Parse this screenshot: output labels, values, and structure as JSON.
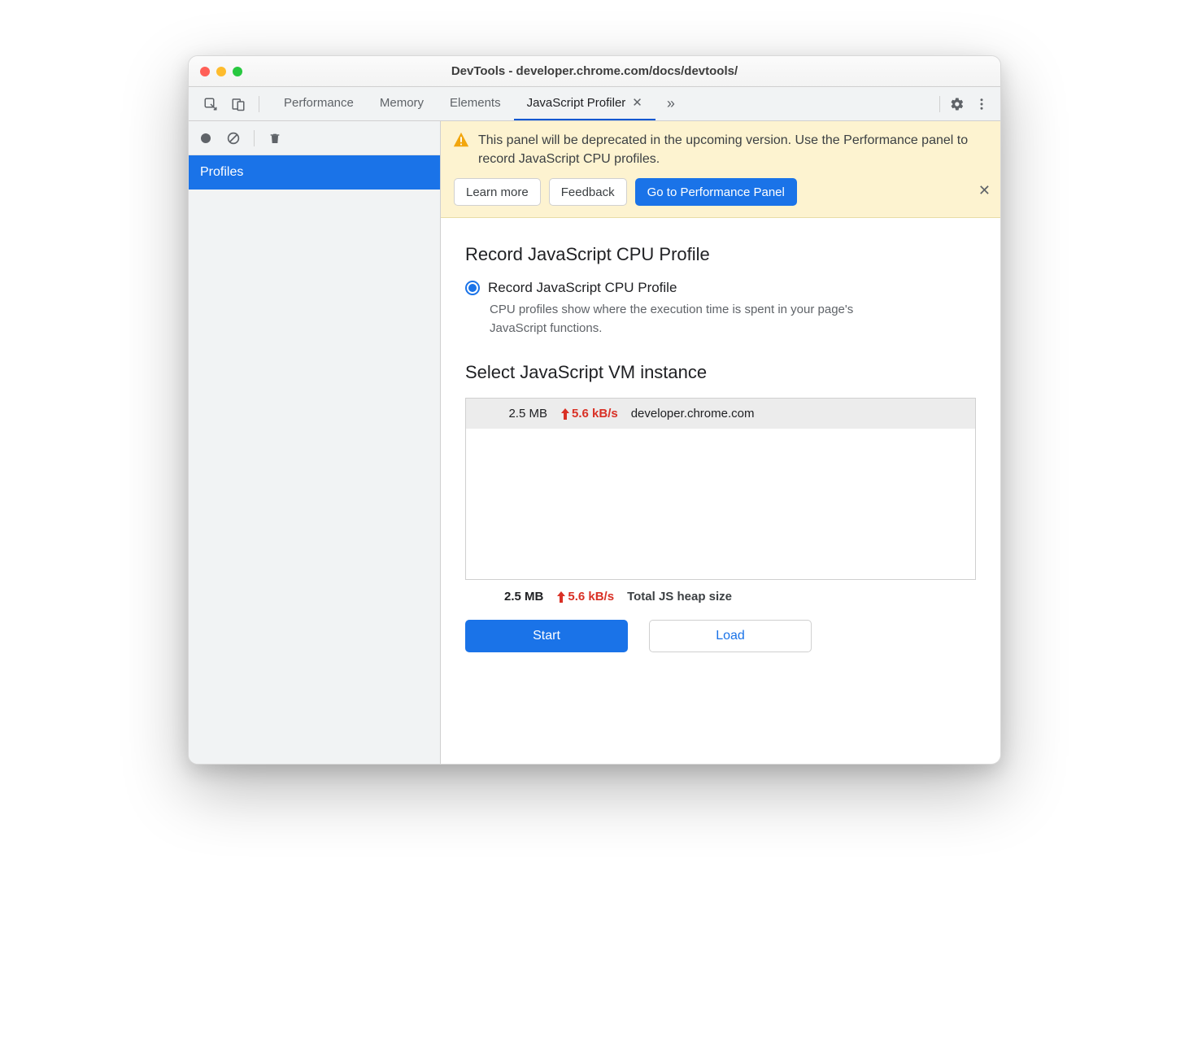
{
  "window": {
    "title": "DevTools - developer.chrome.com/docs/devtools/"
  },
  "tabs": {
    "items": [
      {
        "label": "Performance"
      },
      {
        "label": "Memory"
      },
      {
        "label": "Elements"
      },
      {
        "label": "JavaScript Profiler"
      }
    ],
    "active_index": 3
  },
  "sidebar": {
    "items": [
      {
        "label": "Profiles"
      }
    ]
  },
  "banner": {
    "text": "This panel will be deprecated in the upcoming version. Use the Performance panel to record JavaScript CPU profiles.",
    "learn_more": "Learn more",
    "feedback": "Feedback",
    "goto": "Go to Performance Panel"
  },
  "profile": {
    "heading": "Record JavaScript CPU Profile",
    "radio_label": "Record JavaScript CPU Profile",
    "radio_desc": "CPU profiles show where the execution time is spent in your page's JavaScript functions."
  },
  "vm": {
    "heading": "Select JavaScript VM instance",
    "row": {
      "size": "2.5 MB",
      "rate": "5.6 kB/s",
      "host": "developer.chrome.com"
    },
    "total": {
      "size": "2.5 MB",
      "rate": "5.6 kB/s",
      "caption": "Total JS heap size"
    }
  },
  "actions": {
    "start": "Start",
    "load": "Load"
  }
}
